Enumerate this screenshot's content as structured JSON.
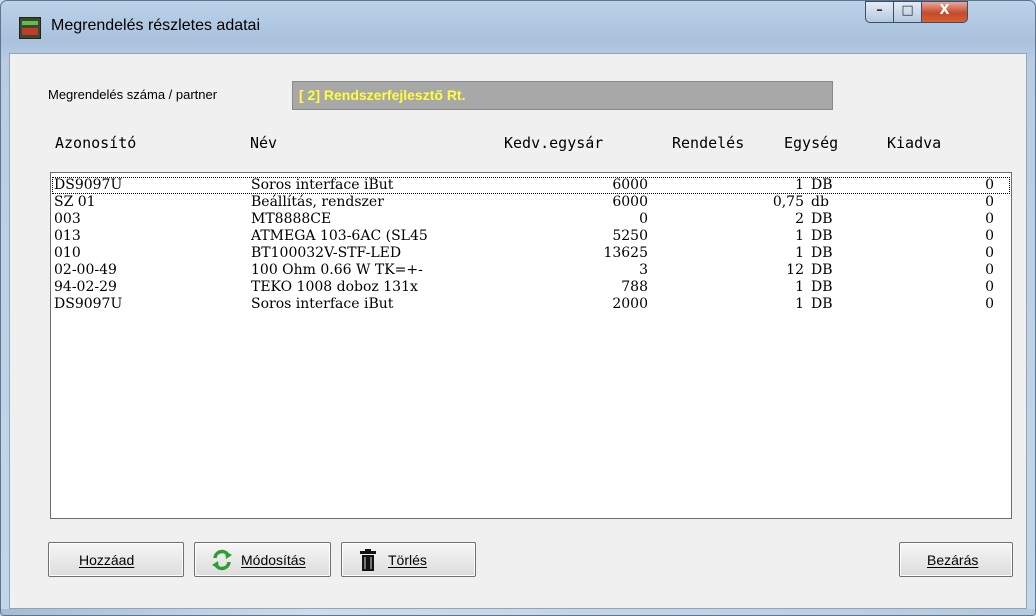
{
  "window": {
    "title": "Megrendelés részletes adatai",
    "controls": {
      "minimize": "–",
      "maximize": "□",
      "close": "X"
    }
  },
  "partner": {
    "label": "Megrendelés száma / partner",
    "value": "[    2] Rendszerfejlesztő Rt."
  },
  "columns": {
    "id": "Azonosító",
    "name": "Név",
    "price": "Kedv.egysár",
    "order": "Rendelés",
    "unit": "Egység",
    "issued": "Kiadva"
  },
  "rows": [
    {
      "id": "DS9097U",
      "name": "Soros interface iBut",
      "price": "6000",
      "qty": "1",
      "unit": "DB",
      "issued": "0"
    },
    {
      "id": "SZ 01",
      "name": "Beállítás, rendszer",
      "price": "6000",
      "qty": "0,75",
      "unit": "db",
      "issued": "0"
    },
    {
      "id": "003",
      "name": "MT8888CE",
      "price": "0",
      "qty": "2",
      "unit": "DB",
      "issued": "0"
    },
    {
      "id": "013",
      "name": "ATMEGA 103-6AC (SL45",
      "price": "5250",
      "qty": "1",
      "unit": "DB",
      "issued": "0"
    },
    {
      "id": "010",
      "name": "BT100032V-STF-LED",
      "price": "13625",
      "qty": "1",
      "unit": "DB",
      "issued": "0"
    },
    {
      "id": "02-00-49",
      "name": "100 Ohm 0.66 W TK=+-",
      "price": "3",
      "qty": "12",
      "unit": "DB",
      "issued": "0"
    },
    {
      "id": "94-02-29",
      "name": "TEKO 1008 doboz 131x",
      "price": "788",
      "qty": "1",
      "unit": "DB",
      "issued": "0"
    },
    {
      "id": "DS9097U",
      "name": "Soros interface iBut",
      "price": "2000",
      "qty": "1",
      "unit": "DB",
      "issued": "0"
    }
  ],
  "buttons": {
    "add": "Hozzáad",
    "modify": "Módosítás",
    "delete": "Törlés",
    "close": "Bezárás"
  },
  "colors": {
    "partner_text": "#ffff3c",
    "partner_bg": "#a8a8a8"
  }
}
